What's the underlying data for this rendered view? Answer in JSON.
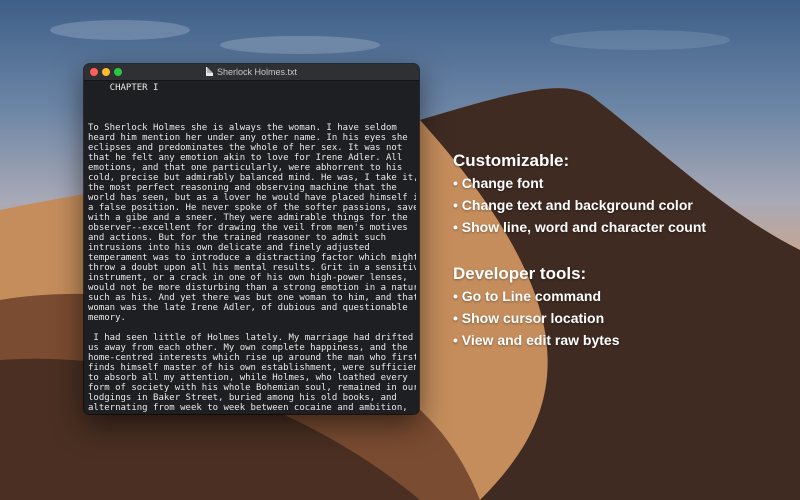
{
  "window": {
    "title": "Sherlock Holmes.txt",
    "file_icon": "text-file-icon"
  },
  "editor": {
    "text": "    CHAPTER I\n\n\n\nTo Sherlock Holmes she is always the woman. I have seldom\nheard him mention her under any other name. In his eyes she\neclipses and predominates the whole of her sex. It was not\nthat he felt any emotion akin to love for Irene Adler. All\nemotions, and that one particularly, were abhorrent to his\ncold, precise but admirably balanced mind. He was, I take it,\nthe most perfect reasoning and observing machine that the\nworld has seen, but as a lover he would have placed himself in\na false position. He never spoke of the softer passions, save\nwith a gibe and a sneer. They were admirable things for the\nobserver--excellent for drawing the veil from men's motives\nand actions. But for the trained reasoner to admit such\nintrusions into his own delicate and finely adjusted\ntemperament was to introduce a distracting factor which might\nthrow a doubt upon all his mental results. Grit in a sensitive\ninstrument, or a crack in one of his own high-power lenses,\nwould not be more disturbing than a strong emotion in a nature\nsuch as his. And yet there was but one woman to him, and that\nwoman was the late Irene Adler, of dubious and questionable\nmemory.\n\n I had seen little of Holmes lately. My marriage had drifted\nus away from each other. My own complete happiness, and the\nhome-centred interests which rise up around the man who first\nfinds himself master of his own establishment, were sufficient\nto absorb all my attention, while Holmes, who loathed every\nform of society with his whole Bohemian soul, remained in our\nlodgings in Baker Street, buried among his old books, and\nalternating from week to week between cocaine and ambition,"
  },
  "marketing": {
    "section1": {
      "heading": "Customizable:",
      "items": [
        "Change font",
        "Change text and background color",
        "Show line, word and character count"
      ]
    },
    "section2": {
      "heading": "Developer tools:",
      "items": [
        "Go to Line command",
        "Show cursor location",
        "View and edit raw bytes"
      ]
    }
  }
}
